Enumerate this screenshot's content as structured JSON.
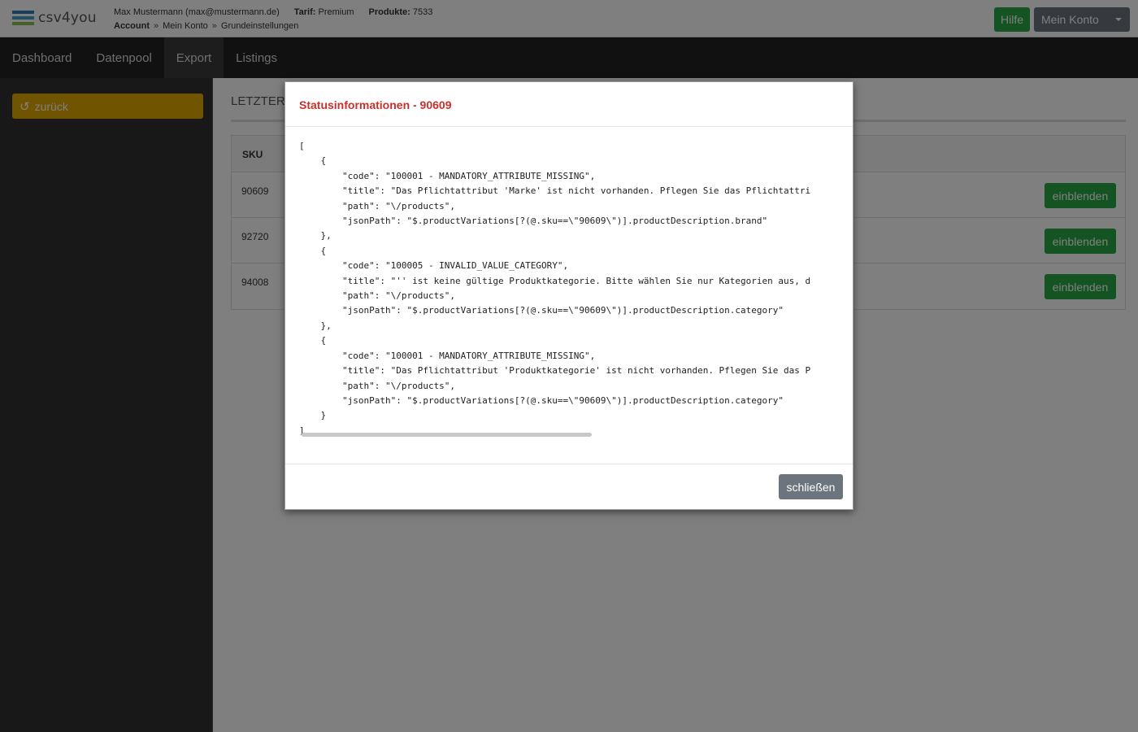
{
  "header": {
    "logo_text": "csv4you",
    "logo_colors": [
      "#2a7fb8",
      "#4aa0c8",
      "#8bc34a"
    ],
    "user": "Max Mustermann (max@mustermann.de)",
    "tarif_label": "Tarif:",
    "tarif_value": "Premium",
    "produkte_label": "Produkte:",
    "produkte_value": "7533",
    "breadcrumb": [
      "Account",
      "Mein Konto",
      "Grundeinstellungen"
    ],
    "breadcrumb_sep": "»",
    "help_label": "Hilfe",
    "account_label": "Mein Konto"
  },
  "nav": {
    "items": [
      "Dashboard",
      "Datenpool",
      "Export",
      "Listings"
    ],
    "active": "Export"
  },
  "sidebar": {
    "back_label": "zurück",
    "back_icon": "undo-icon"
  },
  "main": {
    "title": "LETZTER",
    "table": {
      "header_sku": "SKU",
      "rows": [
        {
          "sku": "90609",
          "action": "einblenden"
        },
        {
          "sku": "92720",
          "action": "einblenden"
        },
        {
          "sku": "94008",
          "action": "einblenden"
        }
      ]
    }
  },
  "modal": {
    "title": "Statusinformationen - 90609",
    "json_text": "[\n    {\n        \"code\": \"100001 - MANDATORY_ATTRIBUTE_MISSING\",\n        \"title\": \"Das Pflichtattribut 'Marke' ist nicht vorhanden. Pflegen Sie das Pflichtattri\n        \"path\": \"\\/products\",\n        \"jsonPath\": \"$.productVariations[?(@.sku==\\\"90609\\\")].productDescription.brand\"\n    },\n    {\n        \"code\": \"100005 - INVALID_VALUE_CATEGORY\",\n        \"title\": \"'' ist keine gültige Produktkategorie. Bitte wählen Sie nur Kategorien aus, d\n        \"path\": \"\\/products\",\n        \"jsonPath\": \"$.productVariations[?(@.sku==\\\"90609\\\")].productDescription.category\"\n    },\n    {\n        \"code\": \"100001 - MANDATORY_ATTRIBUTE_MISSING\",\n        \"title\": \"Das Pflichtattribut 'Produktkategorie' ist nicht vorhanden. Pflegen Sie das P\n        \"path\": \"\\/products\",\n        \"jsonPath\": \"$.productVariations[?(@.sku==\\\"90609\\\")].productDescription.category\"\n    }\n]",
    "close_label": "schließen"
  }
}
